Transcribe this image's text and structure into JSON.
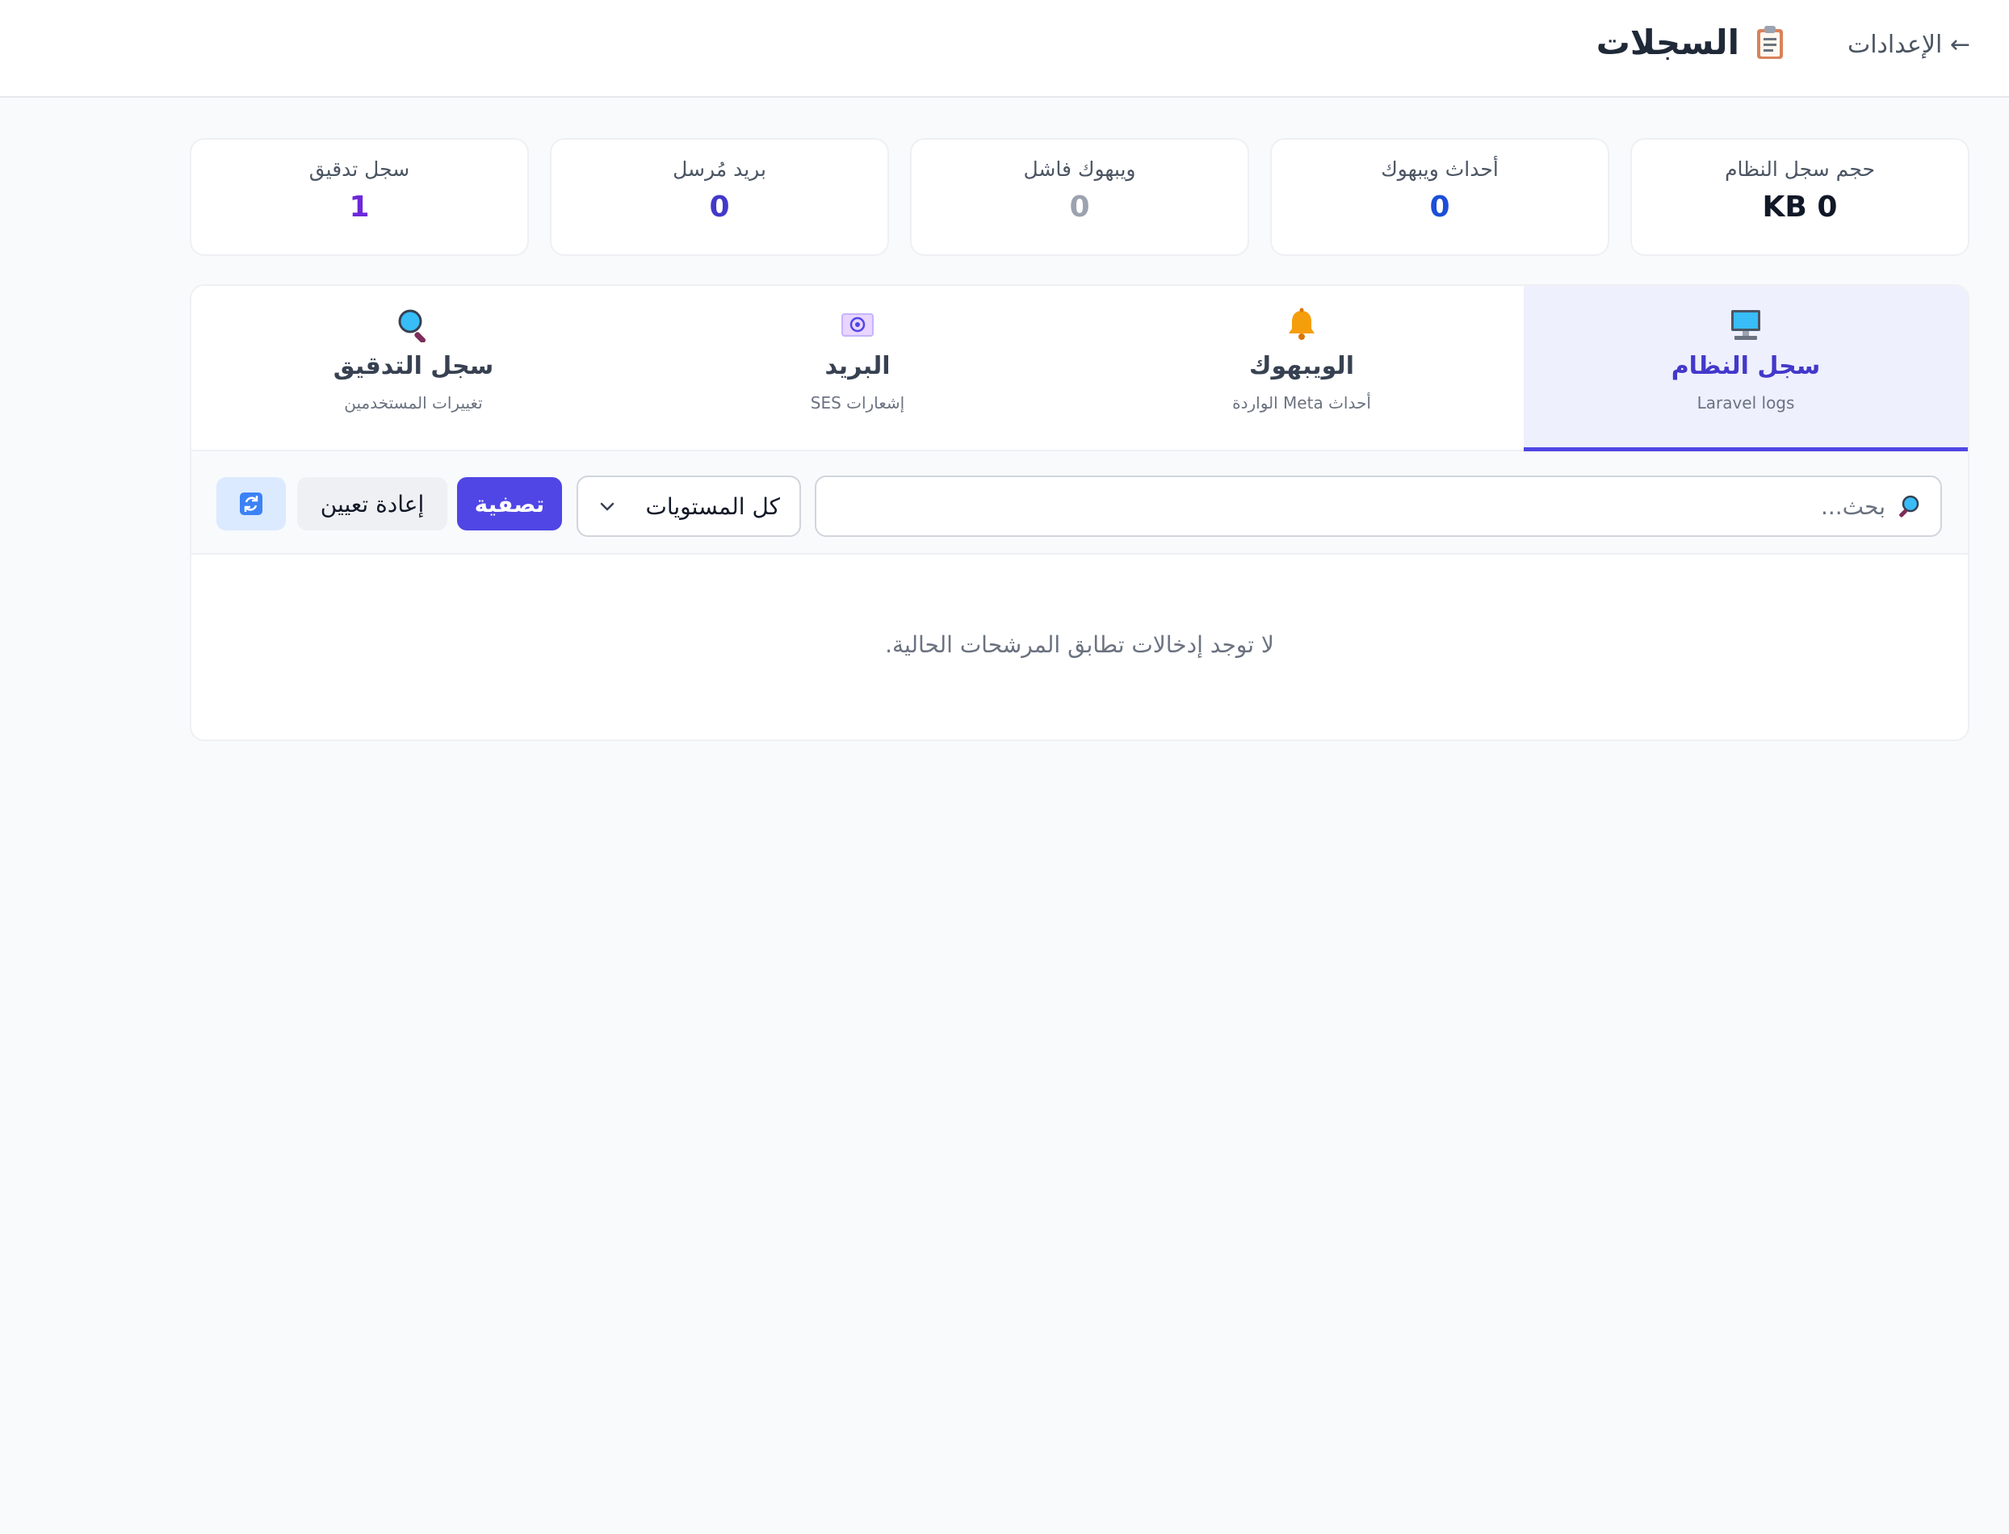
{
  "header": {
    "title": "السجلات",
    "back_label": "← الإعدادات"
  },
  "stats": [
    {
      "label": "حجم سجل النظام",
      "value": "KB 0",
      "color": "#111827"
    },
    {
      "label": "أحداث ويبهوك",
      "value": "0",
      "color": "#1d4ed8"
    },
    {
      "label": "ويبهوك فاشل",
      "value": "0",
      "color": "#9ca3af"
    },
    {
      "label": "بريد مُرسل",
      "value": "0",
      "color": "#4338ca"
    },
    {
      "label": "سجل تدقيق",
      "value": "1",
      "color": "#6d28d9"
    }
  ],
  "tabs": [
    {
      "title": "سجل النظام",
      "subtitle": "Laravel logs",
      "icon": "computer-icon",
      "active": true
    },
    {
      "title": "الويبهوك",
      "subtitle": "أحداث Meta الواردة",
      "icon": "bell-icon",
      "active": false
    },
    {
      "title": "البريد",
      "subtitle": "إشعارات SES",
      "icon": "email-icon",
      "active": false
    },
    {
      "title": "سجل التدقيق",
      "subtitle": "تغييرات المستخدمين",
      "icon": "magnifier-icon",
      "active": false
    }
  ],
  "toolbar": {
    "search_placeholder": "بحث...",
    "level_select": "كل المستويات",
    "filter_label": "تصفية",
    "reset_label": "إعادة تعيين",
    "refresh_icon": "refresh-icon"
  },
  "empty_message": "لا توجد إدخالات تطابق المرشحات الحالية."
}
